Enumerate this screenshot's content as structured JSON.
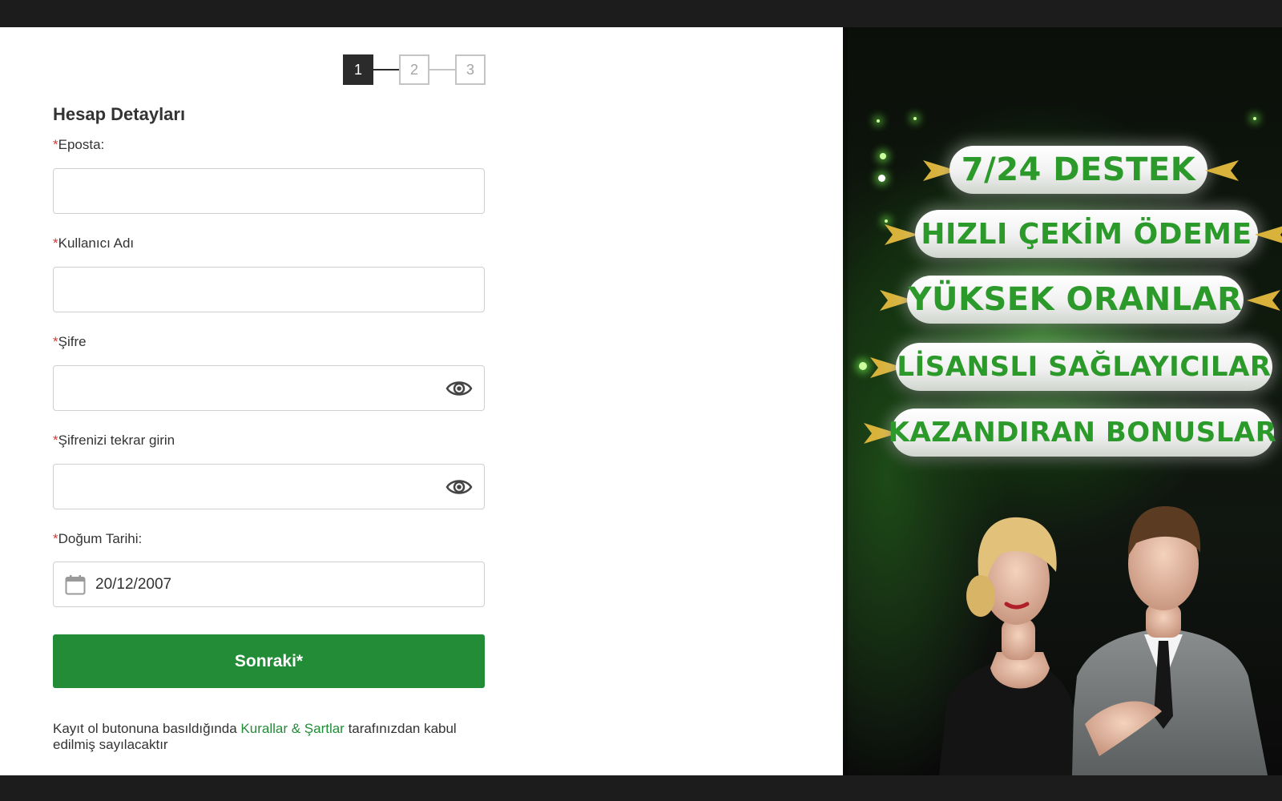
{
  "steps": [
    "1",
    "2",
    "3"
  ],
  "active_step": 1,
  "form": {
    "section_title": "Hesap Detayları",
    "required_marker": "*",
    "email_label": "Eposta:",
    "username_label": "Kullanıcı Adı",
    "password_label": "Şifre",
    "password_repeat_label": "Şifrenizi tekrar girin",
    "birthdate_label": "Doğum Tarihi:",
    "birthdate_value": "20/12/2007",
    "next_label": "Sonraki*"
  },
  "terms": {
    "prefix": "Kayıt ol butonuna basıldığında ",
    "link": "Kurallar & Şartlar",
    "suffix": " tarafınızdan kabul edilmiş sayılacaktır"
  },
  "promo": {
    "ribbons": [
      "7/24 DESTEK",
      "HIZLI ÇEKİM ÖDEME",
      "YÜKSEK ORANLAR",
      "LİSANSLI SAĞLAYICILAR",
      "KAZANDIRAN BONUSLAR"
    ]
  },
  "colors": {
    "accent_green": "#228c37",
    "required_red": "#d23b3b",
    "step_active": "#2b2b2b"
  },
  "icons": [
    "eye-icon",
    "calendar-icon",
    "arrow-icon"
  ]
}
